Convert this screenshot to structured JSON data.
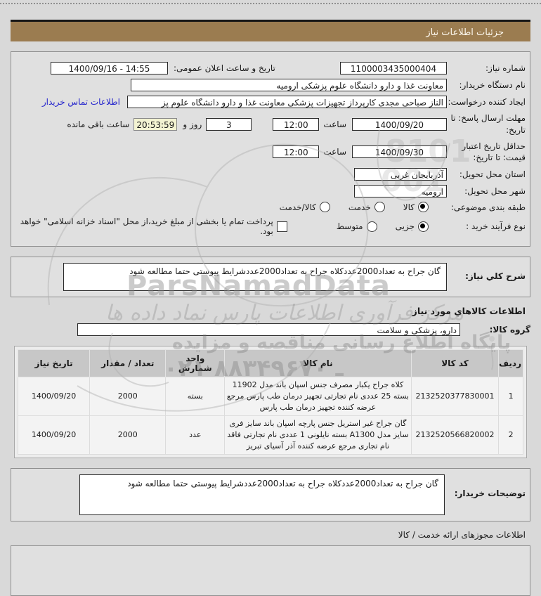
{
  "title_bar": {
    "title": "جزئیات اطلاعات نیاز"
  },
  "form": {
    "need_number_label": "شماره نیاز:",
    "need_number": "1100003435000404",
    "announce_label": "تاریخ و ساعت اعلان عمومی:",
    "announce_value": "1400/09/16 - 14:55",
    "buyer_name_label": "نام دستگاه خریدار:",
    "buyer_name": "معاونت غذا و دارو دانشگاه علوم پزشکی ارومیه",
    "requester_label": "ایجاد کننده درخواست:",
    "requester": "الناز صباحی مجدی کارپرداز تجهیزات پزشکی معاونت غذا و دارو دانشگاه علوم پز",
    "contact_link": "اطلاعات تماس خریدار",
    "deadline_label_1": "مهلت ارسال پاسخ: تا",
    "deadline_label_2": "تاریخ:",
    "deadline_date": "1400/09/20",
    "hour_label": "ساعت",
    "deadline_hour": "12:00",
    "days_value": "3",
    "days_label": "روز و",
    "countdown": "20:53:59",
    "remaining_label": "ساعت باقی مانده",
    "validity_label_1": "حداقل تاریخ اعتبار",
    "validity_label_2": "قیمت: تا تاریخ:",
    "validity_date": "1400/09/30",
    "validity_hour": "12:00",
    "province_label": "استان محل تحویل:",
    "province": "آذربایجان غربی",
    "city_label": "شهر محل تحویل:",
    "city": "ارومیه",
    "classification_label": "طبقه بندی موضوعی:",
    "classification_options": [
      {
        "label": "کالا",
        "selected": true
      },
      {
        "label": "خدمت",
        "selected": false
      },
      {
        "label": "کالا/خدمت",
        "selected": false
      }
    ],
    "process_label": "نوع فرآیند خرید :",
    "process_options": [
      {
        "label": "جزیی",
        "selected": true
      },
      {
        "label": "متوسط",
        "selected": false
      }
    ],
    "treasury_checkbox": {
      "label": "پرداخت تمام یا بخشی از مبلغ خرید،از محل \"اسناد خزانه اسلامی\" خواهد بود.",
      "checked": false
    }
  },
  "need_desc": {
    "label": "شرح كلي نياز:",
    "text": "گان جراح به تعداد2000عددکلاه جراح به تعداد2000عددشرایط پیوستی حتما مطالعه شود"
  },
  "goods_section": {
    "title": "اطلاعات كالاهاي مورد نياز",
    "group_label": "گروه کالا:",
    "group_value": "دارو، پزشکی و سلامت"
  },
  "table": {
    "headers": [
      "ردیف",
      "کد کالا",
      "نام کالا",
      "واحد شمارش",
      "تعداد / مقدار",
      "تاریخ نیاز"
    ],
    "rows": [
      {
        "row": "1",
        "code": "2132520377830001",
        "name": "کلاه جراح یکبار مصرف جنس اسپان باند مدل 11902 بسته 25 عددی نام تجارتی تجهیز درمان طب پارس مرجع عرضه کننده تجهیز درمان طب پارس",
        "unit": "بسته",
        "qty": "2000",
        "date": "1400/09/20"
      },
      {
        "row": "2",
        "code": "2132520566820002",
        "name": "گان جراح غیر استریل جنس پارچه اسپان باند سایز فری سایز مدل A1300 بسته نایلونی 1 عددی نام تجارتی فاقد نام تجاری مرجع عرضه کننده آذر آسیای تبریز",
        "unit": "عدد",
        "qty": "2000",
        "date": "1400/09/20"
      }
    ]
  },
  "buyer_notes": {
    "label": "توضیحات خریدار:",
    "text": "گان جراح به تعداد2000عددکلاه جراح به تعداد2000عددشرایط پیوستی حتما مطالعه شود"
  },
  "permits": {
    "title": "اطلاعات مجوزهای ارائه خدمت / کالا"
  },
  "watermark": {
    "brand": "ParsNamadData",
    "script_line": "مرکز فرآوری اطلاعات پارس نماد داده ها",
    "slogan": "پایگاه اطلاع رسانی مناقصه و مزایده",
    "phone": "۰۲۱ ـ ۸۸۳۴۹۶۷۰",
    "digits_top": "8101",
    "digits_bottom": "001"
  },
  "colors": {
    "titlebar": "#9b7c50",
    "link": "#2424cc",
    "countdown_bg": "#f3f3d2"
  }
}
